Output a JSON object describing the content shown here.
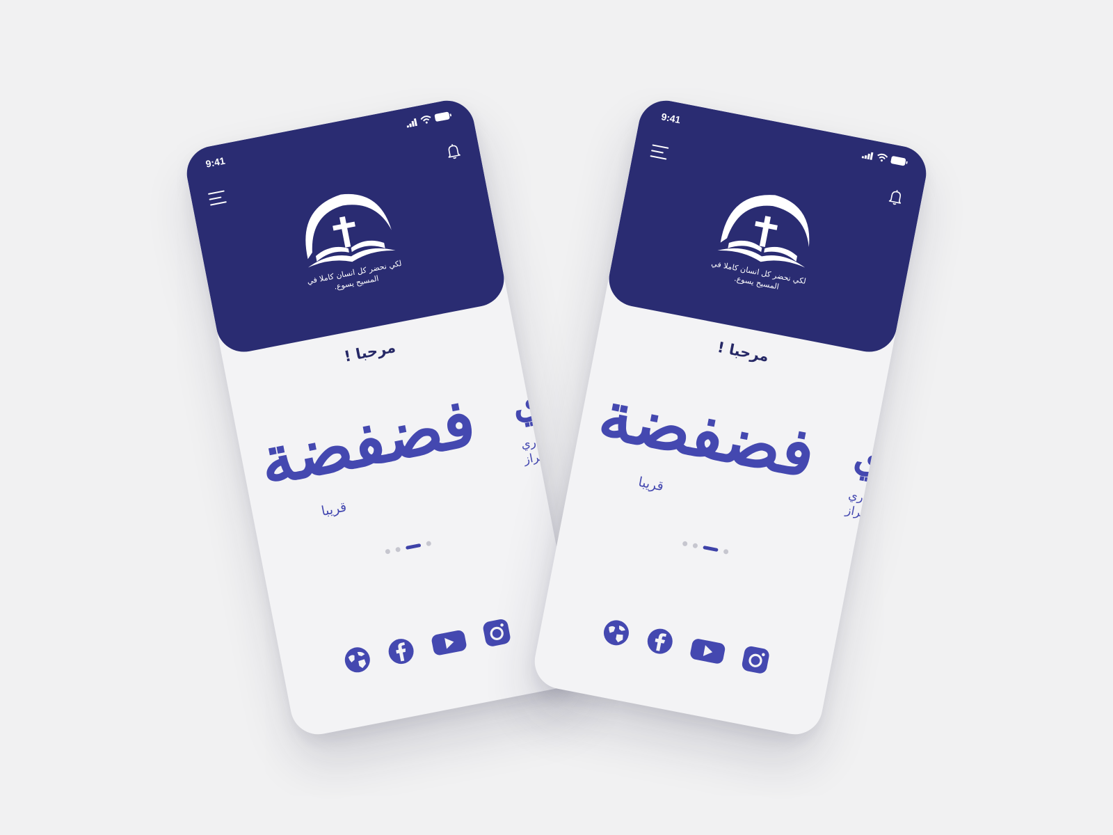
{
  "colors": {
    "background": "#f1f1f2",
    "header": "#2a2c72",
    "accent": "#4448b0",
    "text_dark": "#262866",
    "dot_inactive": "#c6c6cf"
  },
  "status_bar": {
    "time": "9:41",
    "icons": [
      "signal-icon",
      "wifi-icon",
      "battery-icon"
    ]
  },
  "header": {
    "menu_icon": "menu-icon",
    "notification_icon": "bell-icon",
    "logo_icon": "cross-bible-logo-icon",
    "tagline_line1": "لكي نحضر كل انسان كاملا في",
    "tagline_line2": "المسيح يسوع."
  },
  "main": {
    "welcome": "مرحبا !",
    "slides": [
      {
        "title_art": "فضفضة",
        "subtitle": "قريبا"
      },
      {
        "title_art": "ري",
        "line1": "ري",
        "line2": "خراز"
      }
    ],
    "pagination": {
      "count": 4,
      "active_index": 2
    }
  },
  "social_links": [
    {
      "name": "website",
      "icon": "globe-icon"
    },
    {
      "name": "facebook",
      "icon": "facebook-icon"
    },
    {
      "name": "youtube",
      "icon": "youtube-icon"
    },
    {
      "name": "instagram",
      "icon": "instagram-icon"
    }
  ]
}
